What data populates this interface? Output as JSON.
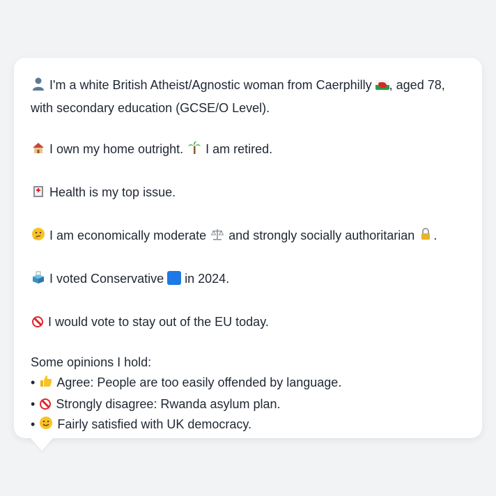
{
  "profile": {
    "intro": {
      "icon": "person-silhouette-icon",
      "line1_a": "I'm a white British Atheist/Agnostic woman from Caerphilly",
      "flag_icon": "wales-flag-icon",
      "line1_b": ", aged 78,",
      "line2": "with secondary education (GCSE/O Level)."
    },
    "home": {
      "icon": "house-icon",
      "text_a": "I own my home outright.",
      "palm_icon": "palm-tree-icon",
      "text_b": "I am retired."
    },
    "issue": {
      "icon": "hospital-icon",
      "text": "Health is my top issue."
    },
    "politics": {
      "icon": "thinking-face-icon",
      "text_a": "I am economically moderate",
      "scales_icon": "balance-scale-icon",
      "text_b": "and strongly socially authoritarian",
      "lock_icon": "padlock-icon",
      "text_c": "."
    },
    "vote": {
      "icon": "ballot-box-icon",
      "text_a": "I voted Conservative",
      "party_icon": "blue-square-icon",
      "party_color": "#1e78e6",
      "text_b": "in 2024."
    },
    "eu": {
      "icon": "prohibited-icon",
      "text": "I would vote to stay out of the EU today."
    },
    "opinions": {
      "heading": "Some opinions I hold:",
      "items": [
        {
          "bullet": "•",
          "icon": "thumbs-up-icon",
          "text": "Agree: People are too easily offended by language."
        },
        {
          "bullet": "•",
          "icon": "prohibited-icon",
          "text": "Strongly disagree: Rwanda asylum plan."
        },
        {
          "bullet": "•",
          "icon": "slightly-smiling-face-icon",
          "text": "Fairly satisfied with UK democracy."
        }
      ]
    }
  }
}
